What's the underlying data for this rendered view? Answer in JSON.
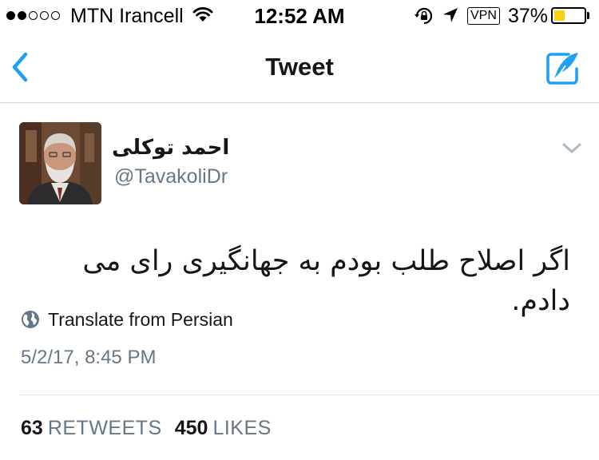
{
  "status_bar": {
    "signal_bars_filled": 2,
    "signal_bars_total": 5,
    "carrier": "MTN Irancell",
    "time": "12:52 AM",
    "vpn": "VPN",
    "battery_percent": "37%",
    "battery_level": 0.37,
    "battery_color": "#f8d10f"
  },
  "nav": {
    "title": "Tweet",
    "accent_color": "#1da1f2",
    "back_icon": "chevron-left-icon",
    "compose_icon": "compose-quill-icon"
  },
  "tweet": {
    "display_name": "احمد توکلی",
    "handle": "@TavakoliDr",
    "text": "اگر اصلاح طلب بودم به جهانگیری رای می دادم.",
    "translate_label": "Translate from Persian",
    "timestamp": "5/2/17, 8:45 PM",
    "retweets_count": "63",
    "retweets_label": "RETWEETS",
    "likes_count": "450",
    "likes_label": "LIKES"
  }
}
